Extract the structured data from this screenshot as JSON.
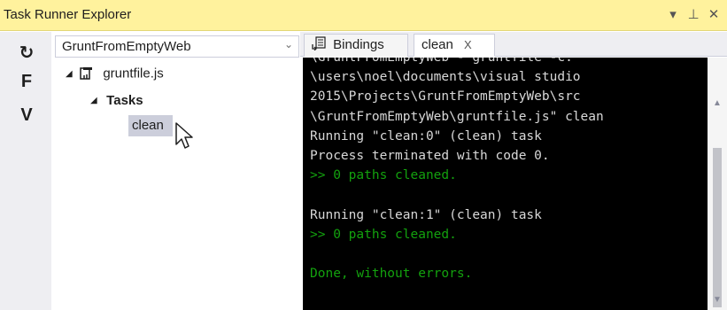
{
  "window": {
    "title": "Task Runner Explorer",
    "buttons": {
      "dropdown": "▾",
      "pin": "⊥",
      "close": "✕"
    }
  },
  "toolbar": {
    "refresh_icon": "↻",
    "f_label": "F",
    "v_label": "V"
  },
  "tree": {
    "project_combo": {
      "value": "GruntFromEmptyWeb",
      "arrow": "⌄"
    },
    "file": {
      "label": "gruntfile.js",
      "icon": "gruntfile-icon"
    },
    "tasks_label": "Tasks",
    "task_items": [
      {
        "label": "clean"
      }
    ]
  },
  "tabs": [
    {
      "label": "Bindings",
      "icon": "bindings-icon"
    },
    {
      "label": "clean",
      "close": "X"
    }
  ],
  "console": {
    "lines": [
      {
        "text": "\\GruntFromEmptyWeb - gruntfile -c:",
        "color": "normal"
      },
      {
        "text": "\\users\\noel\\documents\\visual studio",
        "color": "normal"
      },
      {
        "text": "2015\\Projects\\GruntFromEmptyWeb\\src",
        "color": "normal"
      },
      {
        "text": "\\GruntFromEmptyWeb\\gruntfile.js\" clean",
        "color": "normal"
      },
      {
        "text": "Running \"clean:0\" (clean) task",
        "color": "normal"
      },
      {
        "text": "Process terminated with code 0.",
        "color": "normal"
      },
      {
        "text": ">> 0 paths cleaned.",
        "color": "green"
      },
      {
        "text": "",
        "color": "normal"
      },
      {
        "text": "Running \"clean:1\" (clean) task",
        "color": "normal"
      },
      {
        "text": ">> 0 paths cleaned.",
        "color": "green"
      },
      {
        "text": "",
        "color": "normal"
      },
      {
        "text": "Done, without errors.",
        "color": "green"
      }
    ]
  },
  "colors": {
    "title_bar": "#fff29d",
    "console_bg": "#000000",
    "console_text": "#d8d8d8",
    "console_green": "#13a10e",
    "selection": "#cccedb"
  }
}
